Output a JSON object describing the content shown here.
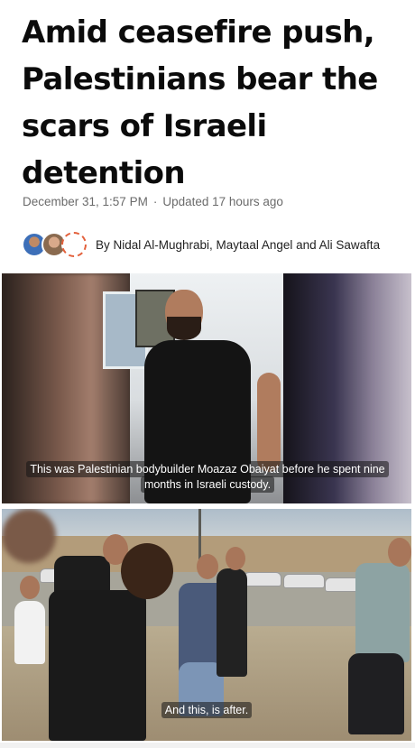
{
  "article": {
    "headline": "Amid ceasefire push, Palestinians bear the scars of Israeli detention",
    "date": "December 31, 1:57 PM",
    "separator": "·",
    "updated": "Updated 17 hours ago",
    "byline": "By Nidal Al-Mughrabi, Maytaal Angel and Ali Sawafta"
  },
  "media": {
    "video1_caption": "This was Palestinian bodybuilder Moazaz Obaiyat before he spent nine months in Israeli custody.",
    "video2_caption": "And this, is after."
  },
  "colors": {
    "headline": "#0b0b0b",
    "meta": "#6b6b6b",
    "caption_bg": "rgba(20,20,20,0.55)"
  },
  "icons": [
    "author-avatar-1",
    "author-avatar-2",
    "author-avatar-3"
  ]
}
